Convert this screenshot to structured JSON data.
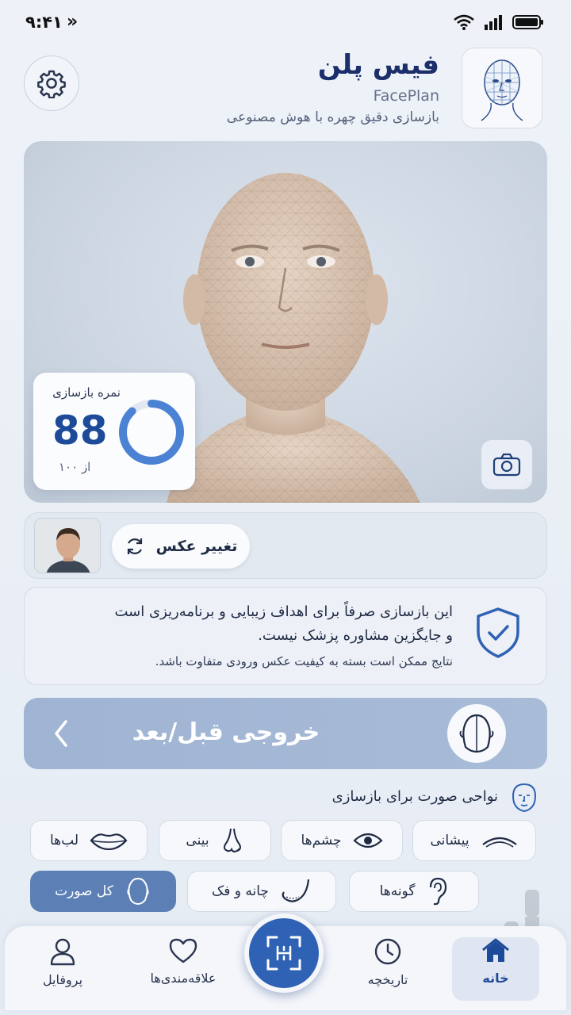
{
  "status_bar": {
    "time": "۹:۴۱",
    "forward_glyph": "»"
  },
  "header": {
    "title": "فیس پلن",
    "title_en": "FacePlan",
    "subtitle": "بازسازی دقیق چهره با هوش مصنوعی"
  },
  "score": {
    "label": "نمره بازسازی",
    "value": "88",
    "of_text": "از ۱۰۰",
    "progress_percent": 88
  },
  "photo_strip": {
    "change_label": "تغییر عکس"
  },
  "disclaimer": {
    "line1": "این بازسازی صرفاً برای اهداف زیبایی و برنامه‌ریزی است",
    "line2": "و جایگزین مشاوره پزشک نیست.",
    "line3": "نتایج ممکن است بسته به کیفیت عکس ورودی متفاوت باشد."
  },
  "before_after": {
    "label": "خروجی قبل/بعد"
  },
  "regions": {
    "title": "نواحی صورت برای بازسازی",
    "chips": [
      {
        "label": "پیشانی",
        "icon": "brow-icon"
      },
      {
        "label": "چشم‌ها",
        "icon": "eye-icon"
      },
      {
        "label": "بینی",
        "icon": "nose-icon"
      },
      {
        "label": "لب‌ها",
        "icon": "lips-icon"
      },
      {
        "label": "گونه‌ها",
        "icon": "ear-icon"
      },
      {
        "label": "چانه و فک",
        "icon": "jaw-icon"
      },
      {
        "label": "کل صورت",
        "icon": "face-outline-icon",
        "active": true
      }
    ]
  },
  "nav": {
    "home": "خانه",
    "history": "تاریخچه",
    "favorites": "علاقه‌مندی‌ها",
    "profile": "پروفایل"
  },
  "colors": {
    "accent": "#2f62b4",
    "title": "#1c2f6b",
    "active_chip": "#5c7fb5"
  }
}
